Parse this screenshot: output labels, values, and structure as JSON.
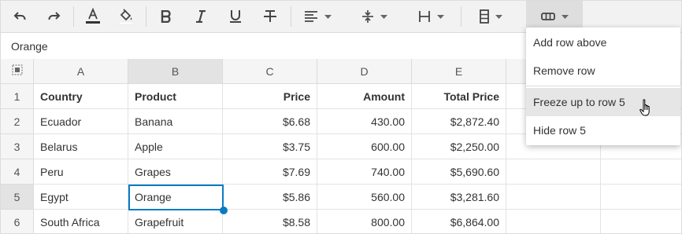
{
  "toolbar": {
    "icons": [
      "undo-icon",
      "redo-icon",
      "text-color-icon",
      "fill-color-icon",
      "bold-icon",
      "italic-icon",
      "underline-icon",
      "strikethrough-icon",
      "align-horizontal-icon",
      "align-vertical-icon",
      "column-width-icon",
      "row-height-icon",
      "rows-icon"
    ],
    "accent": "#0a7ac4"
  },
  "formula_bar": {
    "value": "Orange"
  },
  "columns": [
    "A",
    "B",
    "C",
    "D",
    "E",
    "",
    ""
  ],
  "rows": [
    {
      "num": "1",
      "cells": [
        "Country",
        "Product",
        "Price",
        "Amount",
        "Total Price"
      ]
    },
    {
      "num": "2",
      "cells": [
        "Ecuador",
        "Banana",
        "$6.68",
        "430.00",
        "$2,872.40"
      ]
    },
    {
      "num": "3",
      "cells": [
        "Belarus",
        "Apple",
        "$3.75",
        "600.00",
        "$2,250.00"
      ]
    },
    {
      "num": "4",
      "cells": [
        "Peru",
        "Grapes",
        "$7.69",
        "740.00",
        "$5,690.60"
      ]
    },
    {
      "num": "5",
      "cells": [
        "Egypt",
        "Orange",
        "$5.86",
        "560.00",
        "$3,281.60"
      ]
    },
    {
      "num": "6",
      "cells": [
        "South Africa",
        "Grapefruit",
        "$8.58",
        "800.00",
        "$6,864.00"
      ]
    }
  ],
  "selected_cell": "B5",
  "context_menu": {
    "items": [
      "Add row above",
      "Remove row",
      "Freeze up to row 5",
      "Hide row 5"
    ],
    "hovered": "Freeze up to row 5"
  }
}
